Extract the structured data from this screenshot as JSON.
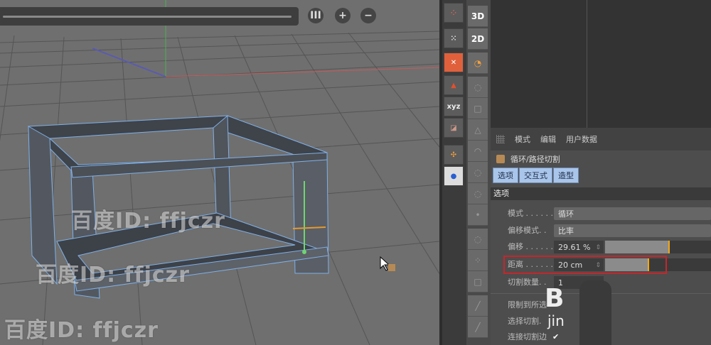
{
  "viewport": {
    "buttons": [
      {
        "icon": "pause-icon",
        "label": "III"
      },
      {
        "icon": "plus-icon",
        "label": "+"
      },
      {
        "icon": "minus-icon",
        "label": "−"
      }
    ],
    "watermarks": [
      "百度ID: ffjczr",
      "百度ID: ffjczr",
      "百度ID: ffjczr"
    ],
    "axis_colors": {
      "x": "#c85a5a",
      "y": "#4caf50",
      "z": "#5a5ab4"
    },
    "selection_color": "#7fb0e8"
  },
  "toolbar": {
    "left": [
      "polygon-points-icon",
      "points-icon",
      "convert-icon",
      "triangle-tools-icon",
      "axis-xyz-icon",
      "snap-icon",
      "move-points-icon",
      "spheres-drop-icon"
    ],
    "right": [
      {
        "label": "3D"
      },
      {
        "label": "2D"
      }
    ]
  },
  "attributes": {
    "menu": [
      "模式",
      "编辑",
      "用户数据"
    ],
    "object_title": "循环/路径切割",
    "tabs": [
      "选项",
      "交互式",
      "造型"
    ],
    "section": "选项",
    "rows": [
      {
        "label": "模式 . . . . . .",
        "value": "循环"
      },
      {
        "label": "偏移模式. .",
        "value": "比率"
      },
      {
        "label": "偏移 . . . . . .",
        "value": "29.61 %",
        "slider": 0.2961
      },
      {
        "label": "距离 . . . . . .",
        "value": "20 cm",
        "slider": 0.2
      },
      {
        "label": "切割数量. .",
        "value": "1"
      },
      {
        "label": "限制到所选",
        "value": ""
      },
      {
        "label": "选择切割.",
        "value": ""
      },
      {
        "label": "连接切割边",
        "value": "✔"
      }
    ],
    "overlay_text": [
      "B",
      "jin"
    ]
  }
}
